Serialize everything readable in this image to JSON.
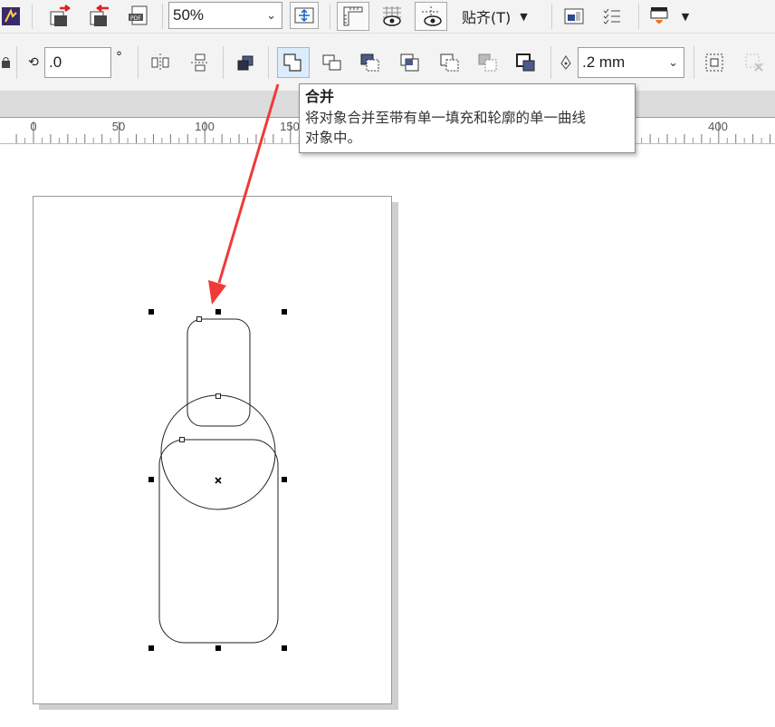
{
  "toolbar_top": {
    "zoom": {
      "value": "50%"
    },
    "snap": {
      "label": "贴齐(T)"
    },
    "icons": [
      "app-launch-icon",
      "import-icon",
      "export-icon",
      "publish-pdf-icon",
      "full-screen-preview-icon",
      "show-rulers-icon",
      "display-mode-icon",
      "snap-guides-icon",
      "welcome-screen-icon",
      "options-icon",
      "color-palette-icon"
    ]
  },
  "toolbar_props": {
    "rotation": {
      "value": ".0",
      "unit": "°"
    },
    "outline_width": {
      "value": ".2 mm"
    },
    "shaping_buttons": [
      "combine",
      "weld",
      "trim",
      "intersect",
      "simplify",
      "front-minus-back",
      "back-minus-front",
      "create-boundary"
    ]
  },
  "tooltip": {
    "title": "合并",
    "description_line1": "将对象合并至带有单一填充和轮廓的单一曲线",
    "description_line2": "对象中。"
  },
  "ruler": {
    "labels": [
      "0",
      "50",
      "100",
      "150",
      "400"
    ]
  },
  "colors": {
    "accent_blue": "#6aa6d6",
    "annotation_arrow": "#f03a3a",
    "toolbar_bg": "#f3f3f3"
  }
}
